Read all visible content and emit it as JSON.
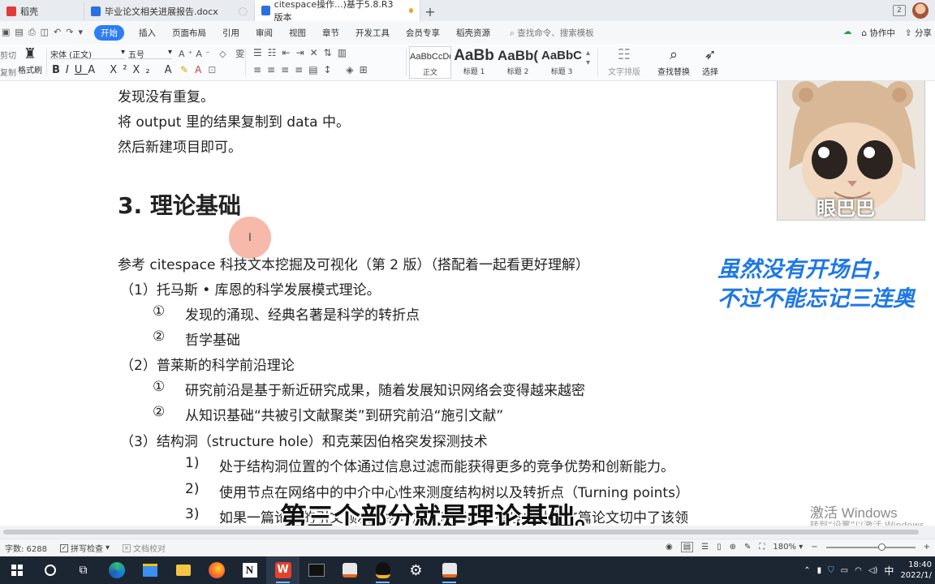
{
  "tabs": [
    {
      "label": "稻壳",
      "color": "#e03b3b"
    },
    {
      "label": "毕业论文相关进展报告.docx",
      "color": "#2c6fe0"
    },
    {
      "label": "citespace操作...)基于5.8.R3版本",
      "color": "#2c6fe0"
    }
  ],
  "title_right": {
    "box": "2"
  },
  "menu": {
    "items": [
      "开始",
      "插入",
      "页面布局",
      "引用",
      "审阅",
      "视图",
      "章节",
      "开发工具",
      "会员专享",
      "稻壳资源"
    ],
    "search": "查找命令、搜索模板",
    "right": [
      "协作中",
      "分享"
    ]
  },
  "ribbon": {
    "cut": "剪切",
    "copy": "复制",
    "format_painter": "格式刷",
    "font_name": "宋体 (正文)",
    "font_size": "五号",
    "styles": [
      {
        "sample": "AaBbCcDd",
        "name": "正文"
      },
      {
        "sample": "AaBb",
        "name": "标题 1"
      },
      {
        "sample": "AaBb(",
        "name": "标题 2"
      },
      {
        "sample": "AaBbC",
        "name": "标题 3"
      }
    ],
    "text_layout": "文字排版",
    "find_replace": "查找替换",
    "select": "选择"
  },
  "document": {
    "lines_top": [
      "发现没有重复。",
      "将 output  里的结果复制到 data 中。",
      "然后新建项目即可。"
    ],
    "heading": "3. 理论基础",
    "reference": "参考 citespace 科技文本挖掘及可视化（第 2 版）（搭配着一起看更好理解）",
    "items": [
      {
        "text": "（1）托马斯 • 库恩的科学发展模式理论。"
      },
      {
        "num": "①",
        "text": "发现的涌现、经典名著是科学的转折点"
      },
      {
        "num": "②",
        "text": "哲学基础"
      },
      {
        "text": "（2）普莱斯的科学前沿理论"
      },
      {
        "num": "①",
        "text": "研究前沿是基于新近研究成果，随着发展知识网络会变得越来越密"
      },
      {
        "num": "②",
        "text": "从知识基础“共被引文献聚类”到研究前沿“施引文献”"
      },
      {
        "text": "（3）结构洞（structure hole）和克莱因伯格突发探测技术"
      },
      {
        "num": "1)",
        "text": "处于结构洞位置的个体通过信息过滤而能获得更多的竞争优势和创新能力。"
      },
      {
        "num": "2)",
        "text": "使用节点在网络中的中介中心性来测度结构树以及转折点（Turning points）"
      },
      {
        "num": "3)",
        "text": "如果一篇论文的引文频次突然增加，就意味着有理由认为这篇论文切中了该领"
      }
    ]
  },
  "sticker": {
    "caption": "眼巴巴"
  },
  "overlay": {
    "line1": "虽然没有开场白，",
    "line2": "不过不能忘记三连奥"
  },
  "subtitle": "第三个部分就是理论基础。",
  "watermark": {
    "line1": "激活 Windows",
    "line2": "转到“设置”以激活 Windows。"
  },
  "status": {
    "word_count": "字数: 6288",
    "spell_check": "拼写检查",
    "doc_proof": "文档校对",
    "zoom": "180%"
  },
  "taskbar": {
    "apps": [
      "search",
      "task-view",
      "edge",
      "store",
      "explorer",
      "firefox",
      "notion",
      "wps",
      "terminal",
      "java",
      "qq",
      "settings",
      "java2"
    ],
    "ime": "中",
    "time": "18:40",
    "date": "2022/1/"
  }
}
